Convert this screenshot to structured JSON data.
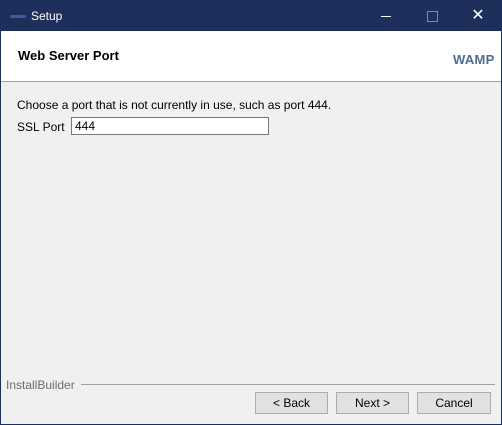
{
  "window": {
    "title": "Setup",
    "close_glyph": "✕"
  },
  "header": {
    "title": "Web Server Port",
    "brand_logo": "WAMP"
  },
  "main": {
    "instructions": "Choose a port that is not currently in use, such as port 444.",
    "ssl_label": "SSL Port",
    "ssl_value": "444"
  },
  "footer": {
    "brand": "InstallBuilder",
    "back_label": "< Back",
    "next_label": "Next >",
    "cancel_label": "Cancel"
  },
  "colors": {
    "titlebar": "#1e2f5c",
    "brand_logo": "#4d6e95"
  },
  "icons": {
    "app": "app-icon",
    "minimize": "minimize-icon",
    "maximize": "maximize-icon",
    "close": "close-icon"
  }
}
